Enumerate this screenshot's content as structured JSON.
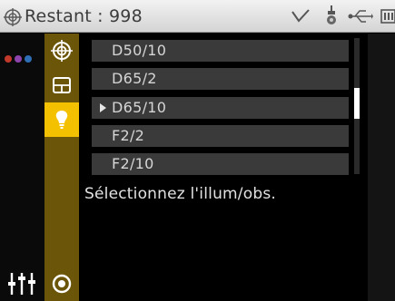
{
  "status_bar": {
    "text": "Restant : 998",
    "icons": [
      "target-icon",
      "check-icon",
      "probe-icon",
      "usb-icon",
      "battery-icon"
    ]
  },
  "sidebar": {
    "dots_colors": [
      "#c0392b",
      "#8e44ad",
      "#2e6fb5"
    ],
    "bottom_icon": "sliders-icon"
  },
  "tabs": [
    {
      "icon": "target-icon",
      "active": false
    },
    {
      "icon": "grid-icon",
      "active": false
    },
    {
      "icon": "lightbulb-icon",
      "active": true
    },
    {
      "icon": "record-icon",
      "active": false
    }
  ],
  "list": {
    "items": [
      {
        "label": "D50/10",
        "selected": false
      },
      {
        "label": "D65/2",
        "selected": false
      },
      {
        "label": "D65/10",
        "selected": true
      },
      {
        "label": "F2/2",
        "selected": false
      },
      {
        "label": "F2/10",
        "selected": false
      }
    ]
  },
  "help_text": "Sélectionnez l'illum/obs.",
  "colors": {
    "accent": "#f4c100",
    "tab_column": "#6b5508",
    "list_item_bg": "#3a3a3a"
  }
}
